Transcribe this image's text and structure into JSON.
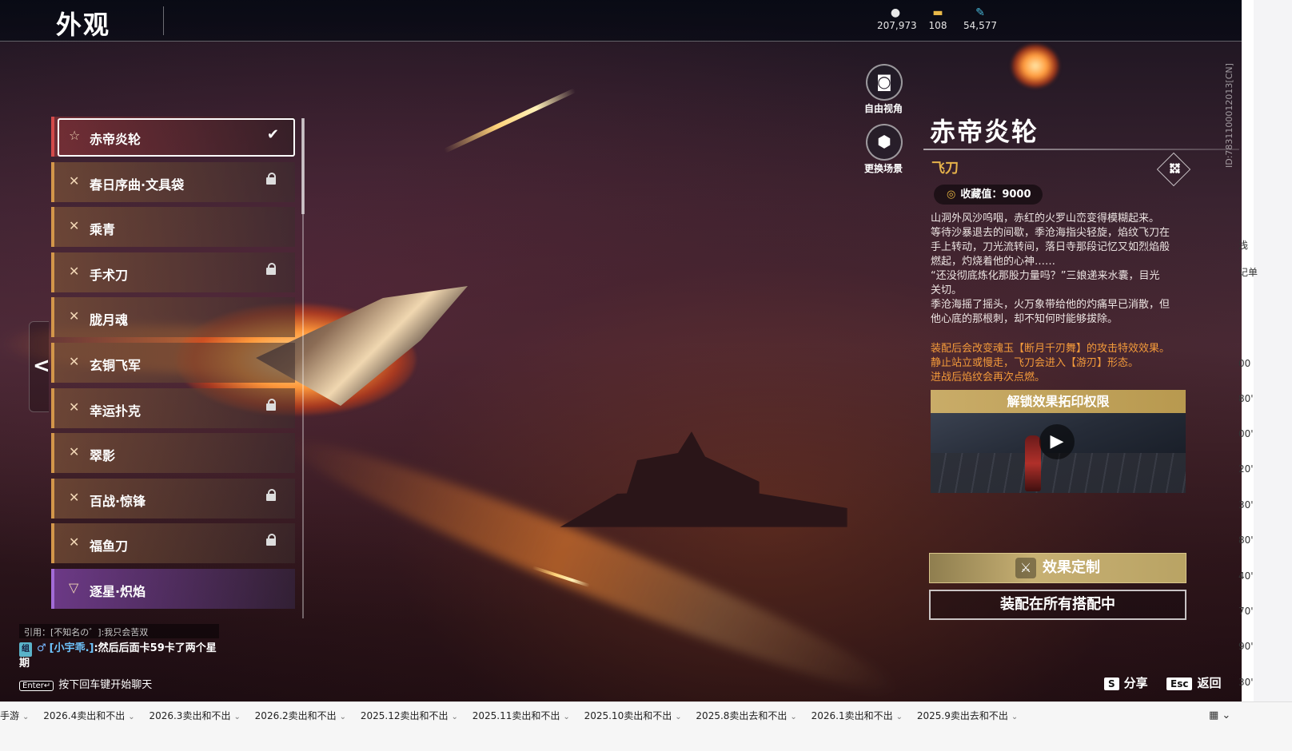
{
  "header": {
    "title": "外观",
    "currencies": [
      {
        "icon": "coins-icon",
        "value": "207,973"
      },
      {
        "icon": "treasure-chest-icon",
        "value": "108"
      },
      {
        "icon": "feather-icon",
        "value": "54,577"
      }
    ]
  },
  "list": {
    "items": [
      {
        "label": "赤帝炎轮",
        "selected": true,
        "locked": false,
        "rarity": "red"
      },
      {
        "label": "春日序曲·文具袋",
        "selected": false,
        "locked": true,
        "rarity": "gold"
      },
      {
        "label": "乘青",
        "selected": false,
        "locked": false,
        "rarity": "gold"
      },
      {
        "label": "手术刀",
        "selected": false,
        "locked": true,
        "rarity": "gold"
      },
      {
        "label": "胧月魂",
        "selected": false,
        "locked": false,
        "rarity": "gold"
      },
      {
        "label": "玄铜飞军",
        "selected": false,
        "locked": false,
        "rarity": "gold"
      },
      {
        "label": "幸运扑克",
        "selected": false,
        "locked": true,
        "rarity": "gold"
      },
      {
        "label": "翠影",
        "selected": false,
        "locked": false,
        "rarity": "gold"
      },
      {
        "label": "百战·惊锋",
        "selected": false,
        "locked": true,
        "rarity": "gold"
      },
      {
        "label": "福鱼刀",
        "selected": false,
        "locked": true,
        "rarity": "gold"
      },
      {
        "label": "逐星·炽焰",
        "selected": false,
        "locked": false,
        "rarity": "purple"
      }
    ]
  },
  "camera": {
    "free_view_label": "自由视角",
    "change_scene_label": "更换场景"
  },
  "detail": {
    "name": "赤帝炎轮",
    "type": "飞刀",
    "collect_value": "收藏值：9000",
    "description": "山洞外风沙呜咽，赤红的火罗山峦变得模糊起来。\n等待沙暴退去的间歇，季沧海指尖轻旋，焰纹飞刀在\n手上转动，刀光流转间，落日寺那段记忆又如烈焰般\n燃起，灼烧着他的心神……\n“还没彻底炼化那股力量吗？”三娘递来水囊，目光\n关切。\n季沧海摇了摇头，火万象带给他的灼痛早已消散，但\n他心底的那根刺，却不知何时能够拔除。",
    "effect": "装配后会改变魂玉【断月千刃舞】的攻击特效效果。\n静止站立或慢走，飞刀会进入【游刃】形态。\n进战后焰纹会再次点燃。",
    "unlock_label": "解锁效果拓印权限",
    "custom_button": "效果定制",
    "equip_button": "装配在所有搭配中",
    "player_id": "ID:7831100012013[CN]"
  },
  "chat": {
    "quote": "引用：[不知名の゛]:我只会苦双",
    "message_badge": "组",
    "message_gender": "♂",
    "message_nick": "[小宇乖.]",
    "message_text": ":然后后面卡59卡了两个星期",
    "enter_key": "Enter↵",
    "hint": "按下回车键开始聊天"
  },
  "hotkeys": {
    "share_key": "S",
    "share_label": "分享",
    "back_key": "Esc",
    "back_label": "返回"
  },
  "taskbar": {
    "tabs": [
      "手游",
      "2026.4卖出和不出",
      "2026.3卖出和不出",
      "2026.2卖出和不出",
      "2025.12卖出和不出",
      "2025.11卖出和不出",
      "2025.10卖出和不出",
      "2025.8卖出去和不出",
      "2026.1卖出和不出",
      "2025.9卖出去和不出"
    ]
  },
  "edge_fragments": [
    "浅",
    "记单",
    "00",
    "80'",
    "00'",
    "20'",
    "30'",
    "80'",
    "40'",
    "70'",
    "90'",
    "30'"
  ],
  "colors": {
    "gold_border": "#d3964a",
    "red_border": "#d34a4a",
    "purple_border": "#a26bd6",
    "type_text": "#e6b24a",
    "effect_text": "#f39a3a"
  }
}
